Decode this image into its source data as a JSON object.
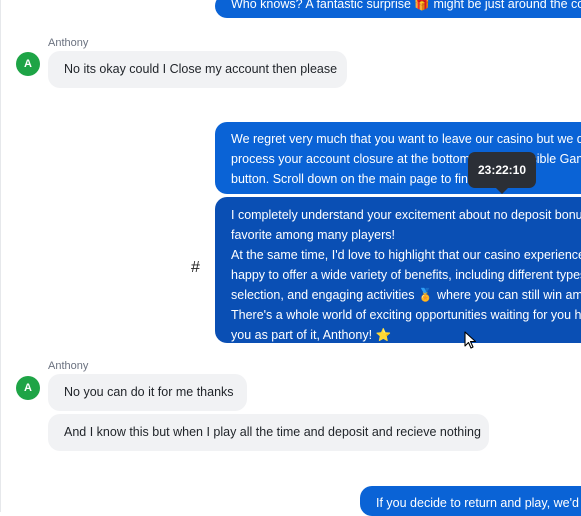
{
  "messages": {
    "top_out": "Who knows? A fantastic surprise 🎁 might be just around the co",
    "anthony1": {
      "sender": "Anthony",
      "initial": "A",
      "text": "No its okay could I Close my account then please"
    },
    "agent1": [
      "We regret very much that you want to leave our casino but we do",
      "process your account closure at the bottom of Responsible Gami",
      "button. Scroll down on the main page to find it"
    ],
    "agent2": [
      "I completely understand your excitement about no deposit bonus",
      "favorite among many players!",
      "At the same time, I'd love to highlight that our casino experience",
      "happy to offer a wide variety of benefits, including different types",
      "selection, and engaging activities 🏅 where you can still win ama",
      "There's a whole world of exciting opportunities waiting for you he",
      "you as part of it, Anthony! ⭐"
    ],
    "anthony2": {
      "sender": "Anthony",
      "initial": "A",
      "text1": "No you can do it for me thanks",
      "text2": "And I know this but when I play all the time and deposit and recieve nothing"
    },
    "bottom_out": "If you decide to return and play, we'd"
  },
  "tooltip": {
    "time": "23:22:10"
  },
  "hover_action": {
    "symbol": "#"
  },
  "colors": {
    "agent_bubble": "#0a63d6",
    "agent_bubble_selected": "#0a4fb4",
    "user_bubble": "#f1f2f4",
    "avatar": "#1ea446"
  }
}
